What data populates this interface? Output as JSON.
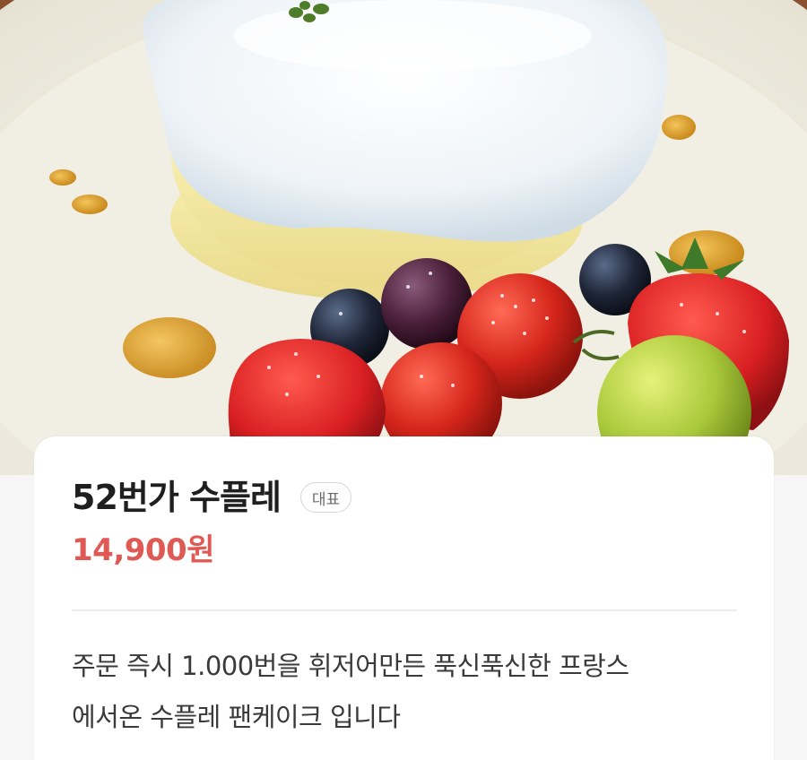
{
  "hero_image": {
    "subject": "souffle pancake with fruit"
  },
  "product": {
    "name": "52번가 수플레",
    "badge": "대표",
    "price": "14,900원",
    "description_lines": [
      "주문 즉시 1.000번을 휘저어만든 푹신푹신한 프랑스",
      "에서온 수플레 팬케이크 입니다"
    ]
  },
  "colors": {
    "price": "#e05a55",
    "title": "#1f1f1f",
    "badge_border": "#d6d6d6",
    "card_bg": "#ffffff"
  }
}
